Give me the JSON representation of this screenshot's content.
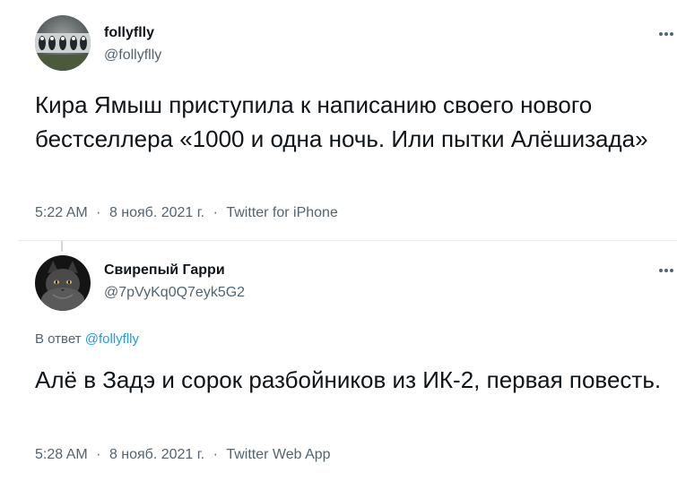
{
  "tweets": [
    {
      "display_name": "follyflly",
      "handle": "@follyflly",
      "text": "Кира Ямыш приступила к написанию своего нового бестселлера «1000 и одна ночь. Или пытки Алёшизада»",
      "time": "5:22 AM",
      "date": "8 нояб. 2021 г.",
      "client": "Twitter for iPhone",
      "separator": "·",
      "avatar_icon": "avatar-image",
      "more_icon": "more-options-icon"
    },
    {
      "display_name": "Свирепый Гарри",
      "handle": "@7pVyKq0Q7eyk5G2",
      "reply_prefix": "В ответ",
      "reply_mention": "@follyflly",
      "text": "Алё в Задэ и сорок разбойников из ИК-2, первая повесть.",
      "time": "5:28 AM",
      "date": "8 нояб. 2021 г.",
      "client": "Twitter Web App",
      "separator": "·",
      "avatar_icon": "avatar-image",
      "more_icon": "more-options-icon"
    }
  ],
  "colors": {
    "text": "#0f1419",
    "secondary": "#536471",
    "link": "#1d9bf0",
    "divider": "#e6ecf0"
  }
}
